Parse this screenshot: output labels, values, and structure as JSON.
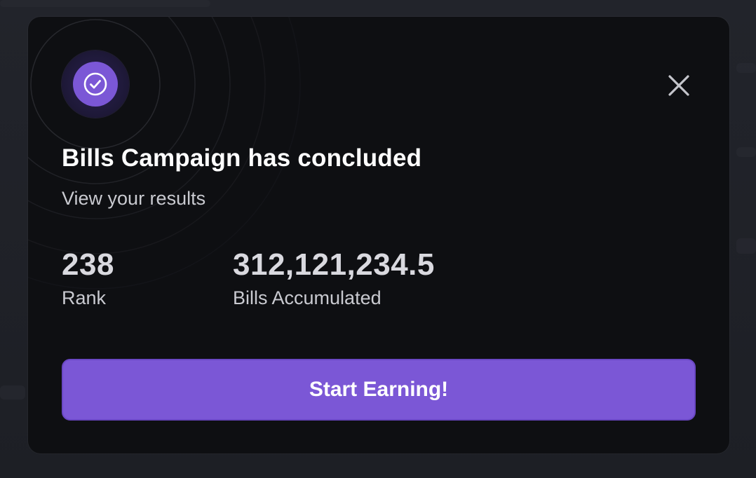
{
  "modal": {
    "title": "Bills Campaign has concluded",
    "subtitle": "View your results",
    "badge_icon": "check-circle-icon",
    "close_icon": "close-icon",
    "stats": {
      "rank": {
        "value": "238",
        "label": "Rank"
      },
      "bills": {
        "value": "312,121,234.5",
        "label": "Bills Accumulated"
      }
    },
    "cta_label": "Start Earning!"
  },
  "colors": {
    "accent": "#7b57d6",
    "modal_bg": "#0e0f12",
    "backdrop": "#1c1e24"
  }
}
